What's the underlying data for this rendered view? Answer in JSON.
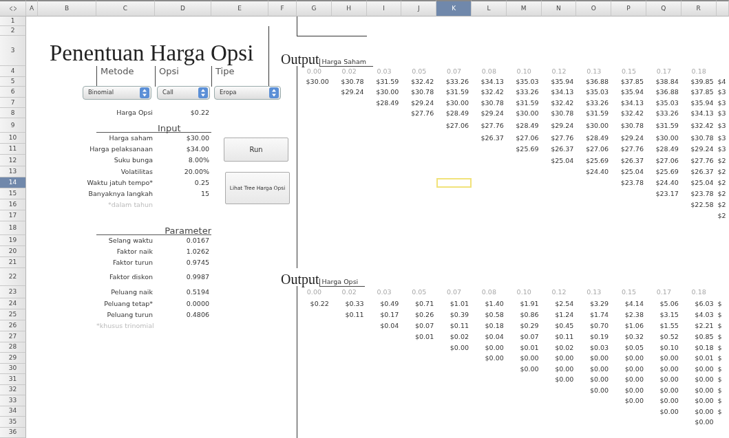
{
  "columns": [
    {
      "label": "A",
      "selected": false
    },
    {
      "label": "B",
      "selected": false
    },
    {
      "label": "C",
      "selected": false
    },
    {
      "label": "D",
      "selected": false
    },
    {
      "label": "E",
      "selected": false
    },
    {
      "label": "F",
      "selected": false
    },
    {
      "label": "G",
      "selected": false
    },
    {
      "label": "H",
      "selected": false
    },
    {
      "label": "I",
      "selected": false
    },
    {
      "label": "J",
      "selected": false
    },
    {
      "label": "K",
      "selected": true
    },
    {
      "label": "L",
      "selected": false
    },
    {
      "label": "M",
      "selected": false
    },
    {
      "label": "N",
      "selected": false
    },
    {
      "label": "O",
      "selected": false
    },
    {
      "label": "P",
      "selected": false
    },
    {
      "label": "Q",
      "selected": false
    },
    {
      "label": "R",
      "selected": false
    }
  ],
  "rows": [
    {
      "label": "1",
      "selected": false
    },
    {
      "label": "2",
      "selected": false
    },
    {
      "label": "3",
      "selected": false
    },
    {
      "label": "4",
      "selected": false
    },
    {
      "label": "5",
      "selected": false
    },
    {
      "label": "6",
      "selected": false
    },
    {
      "label": "7",
      "selected": false
    },
    {
      "label": "8",
      "selected": false
    },
    {
      "label": "9",
      "selected": false
    },
    {
      "label": "10",
      "selected": false
    },
    {
      "label": "11",
      "selected": false
    },
    {
      "label": "12",
      "selected": false
    },
    {
      "label": "13",
      "selected": false
    },
    {
      "label": "14",
      "selected": true
    },
    {
      "label": "15",
      "selected": false
    },
    {
      "label": "16",
      "selected": false
    },
    {
      "label": "17",
      "selected": false
    },
    {
      "label": "18",
      "selected": false
    },
    {
      "label": "19",
      "selected": false
    },
    {
      "label": "20",
      "selected": false
    },
    {
      "label": "21",
      "selected": false
    },
    {
      "label": "22",
      "selected": false
    },
    {
      "label": "23",
      "selected": false
    },
    {
      "label": "24",
      "selected": false
    },
    {
      "label": "25",
      "selected": false
    },
    {
      "label": "26",
      "selected": false
    },
    {
      "label": "27",
      "selected": false
    },
    {
      "label": "28",
      "selected": false
    },
    {
      "label": "29",
      "selected": false
    },
    {
      "label": "30",
      "selected": false
    },
    {
      "label": "31",
      "selected": false
    },
    {
      "label": "32",
      "selected": false
    },
    {
      "label": "33",
      "selected": false
    },
    {
      "label": "34",
      "selected": false
    },
    {
      "label": "35",
      "selected": false
    },
    {
      "label": "36",
      "selected": false
    }
  ],
  "title": "Penentuan Harga Opsi",
  "selectors": [
    {
      "label": "Metode",
      "value": "Binomial"
    },
    {
      "label": "Opsi",
      "value": "Call"
    },
    {
      "label": "Tipe",
      "value": "Eropa"
    }
  ],
  "result": {
    "label": "Harga Opsi",
    "value": "$0.22"
  },
  "input": {
    "heading": "Input",
    "items": [
      {
        "label": "Harga saham",
        "value": "$30.00"
      },
      {
        "label": "Harga pelaksanaan",
        "value": "$34.00"
      },
      {
        "label": "Suku bunga",
        "value": "8.00%"
      },
      {
        "label": "Volatilitas",
        "value": "20.00%"
      },
      {
        "label": "Waktu jatuh tempo*",
        "value": "0.25"
      },
      {
        "label": "Banyaknya langkah",
        "value": "15"
      }
    ],
    "note": "*dalam tahun"
  },
  "parameter": {
    "heading": "Parameter",
    "items": [
      {
        "label": "Selang waktu",
        "value": "0.0167"
      },
      {
        "label": "Faktor naik",
        "value": "1.0262"
      },
      {
        "label": "Faktor turun",
        "value": "0.9745"
      },
      {
        "label": "Faktor diskon",
        "value": "0.9987"
      },
      {
        "label": "Peluang naik",
        "value": "0.5194"
      },
      {
        "label": "Peluang tetap*",
        "value": "0.0000"
      },
      {
        "label": "Peluang turun",
        "value": "0.4806"
      }
    ],
    "note": "*khusus trinomial"
  },
  "buttons": [
    "Run",
    "Lihat Tree Harga Opsi"
  ],
  "outputs": [
    {
      "heading": "Output",
      "subtitle": "Harga Saham",
      "time_steps": [
        "0.00",
        "0.02",
        "0.03",
        "0.05",
        "0.07",
        "0.08",
        "0.10",
        "0.12",
        "0.13",
        "0.15",
        "0.17",
        "0.18"
      ],
      "rows": [
        [
          "$30.00",
          "$30.78",
          "$31.59",
          "$32.42",
          "$33.26",
          "$34.13",
          "$35.03",
          "$35.94",
          "$36.88",
          "$37.85",
          "$38.84",
          "$39.85",
          "$4"
        ],
        [
          null,
          "$29.24",
          "$30.00",
          "$30.78",
          "$31.59",
          "$32.42",
          "$33.26",
          "$34.13",
          "$35.03",
          "$35.94",
          "$36.88",
          "$37.85",
          "$3"
        ],
        [
          null,
          null,
          "$28.49",
          "$29.24",
          "$30.00",
          "$30.78",
          "$31.59",
          "$32.42",
          "$33.26",
          "$34.13",
          "$35.03",
          "$35.94",
          "$3"
        ],
        [
          null,
          null,
          null,
          "$27.76",
          "$28.49",
          "$29.24",
          "$30.00",
          "$30.78",
          "$31.59",
          "$32.42",
          "$33.26",
          "$34.13",
          "$3"
        ],
        [
          null,
          null,
          null,
          null,
          "$27.06",
          "$27.76",
          "$28.49",
          "$29.24",
          "$30.00",
          "$30.78",
          "$31.59",
          "$32.42",
          "$3"
        ],
        [
          null,
          null,
          null,
          null,
          null,
          "$26.37",
          "$27.06",
          "$27.76",
          "$28.49",
          "$29.24",
          "$30.00",
          "$30.78",
          "$3"
        ],
        [
          null,
          null,
          null,
          null,
          null,
          null,
          "$25.69",
          "$26.37",
          "$27.06",
          "$27.76",
          "$28.49",
          "$29.24",
          "$3"
        ],
        [
          null,
          null,
          null,
          null,
          null,
          null,
          null,
          "$25.04",
          "$25.69",
          "$26.37",
          "$27.06",
          "$27.76",
          "$2"
        ],
        [
          null,
          null,
          null,
          null,
          null,
          null,
          null,
          null,
          "$24.40",
          "$25.04",
          "$25.69",
          "$26.37",
          "$2"
        ],
        [
          null,
          null,
          null,
          null,
          null,
          null,
          null,
          null,
          null,
          "$23.78",
          "$24.40",
          "$25.04",
          "$2"
        ],
        [
          null,
          null,
          null,
          null,
          null,
          null,
          null,
          null,
          null,
          null,
          "$23.17",
          "$23.78",
          "$2"
        ],
        [
          null,
          null,
          null,
          null,
          null,
          null,
          null,
          null,
          null,
          null,
          null,
          "$22.58",
          "$2"
        ],
        [
          null,
          null,
          null,
          null,
          null,
          null,
          null,
          null,
          null,
          null,
          null,
          null,
          "$2"
        ]
      ]
    },
    {
      "heading": "Output",
      "subtitle": "Harga Opsi",
      "time_steps": [
        "0.00",
        "0.02",
        "0.03",
        "0.05",
        "0.07",
        "0.08",
        "0.10",
        "0.12",
        "0.13",
        "0.15",
        "0.17",
        "0.18"
      ],
      "rows": [
        [
          "$0.22",
          "$0.33",
          "$0.49",
          "$0.71",
          "$1.01",
          "$1.40",
          "$1.91",
          "$2.54",
          "$3.29",
          "$4.14",
          "$5.06",
          "$6.03",
          "$"
        ],
        [
          null,
          "$0.11",
          "$0.17",
          "$0.26",
          "$0.39",
          "$0.58",
          "$0.86",
          "$1.24",
          "$1.74",
          "$2.38",
          "$3.15",
          "$4.03",
          "$"
        ],
        [
          null,
          null,
          "$0.04",
          "$0.07",
          "$0.11",
          "$0.18",
          "$0.29",
          "$0.45",
          "$0.70",
          "$1.06",
          "$1.55",
          "$2.21",
          "$"
        ],
        [
          null,
          null,
          null,
          "$0.01",
          "$0.02",
          "$0.04",
          "$0.07",
          "$0.11",
          "$0.19",
          "$0.32",
          "$0.52",
          "$0.85",
          "$"
        ],
        [
          null,
          null,
          null,
          null,
          "$0.00",
          "$0.00",
          "$0.01",
          "$0.02",
          "$0.03",
          "$0.05",
          "$0.10",
          "$0.18",
          "$"
        ],
        [
          null,
          null,
          null,
          null,
          null,
          "$0.00",
          "$0.00",
          "$0.00",
          "$0.00",
          "$0.00",
          "$0.00",
          "$0.01",
          "$"
        ],
        [
          null,
          null,
          null,
          null,
          null,
          null,
          "$0.00",
          "$0.00",
          "$0.00",
          "$0.00",
          "$0.00",
          "$0.00",
          "$"
        ],
        [
          null,
          null,
          null,
          null,
          null,
          null,
          null,
          "$0.00",
          "$0.00",
          "$0.00",
          "$0.00",
          "$0.00",
          "$"
        ],
        [
          null,
          null,
          null,
          null,
          null,
          null,
          null,
          null,
          "$0.00",
          "$0.00",
          "$0.00",
          "$0.00",
          "$"
        ],
        [
          null,
          null,
          null,
          null,
          null,
          null,
          null,
          null,
          null,
          "$0.00",
          "$0.00",
          "$0.00",
          "$"
        ],
        [
          null,
          null,
          null,
          null,
          null,
          null,
          null,
          null,
          null,
          null,
          "$0.00",
          "$0.00",
          "$"
        ],
        [
          null,
          null,
          null,
          null,
          null,
          null,
          null,
          null,
          null,
          null,
          null,
          "$0.00"
        ]
      ]
    }
  ]
}
